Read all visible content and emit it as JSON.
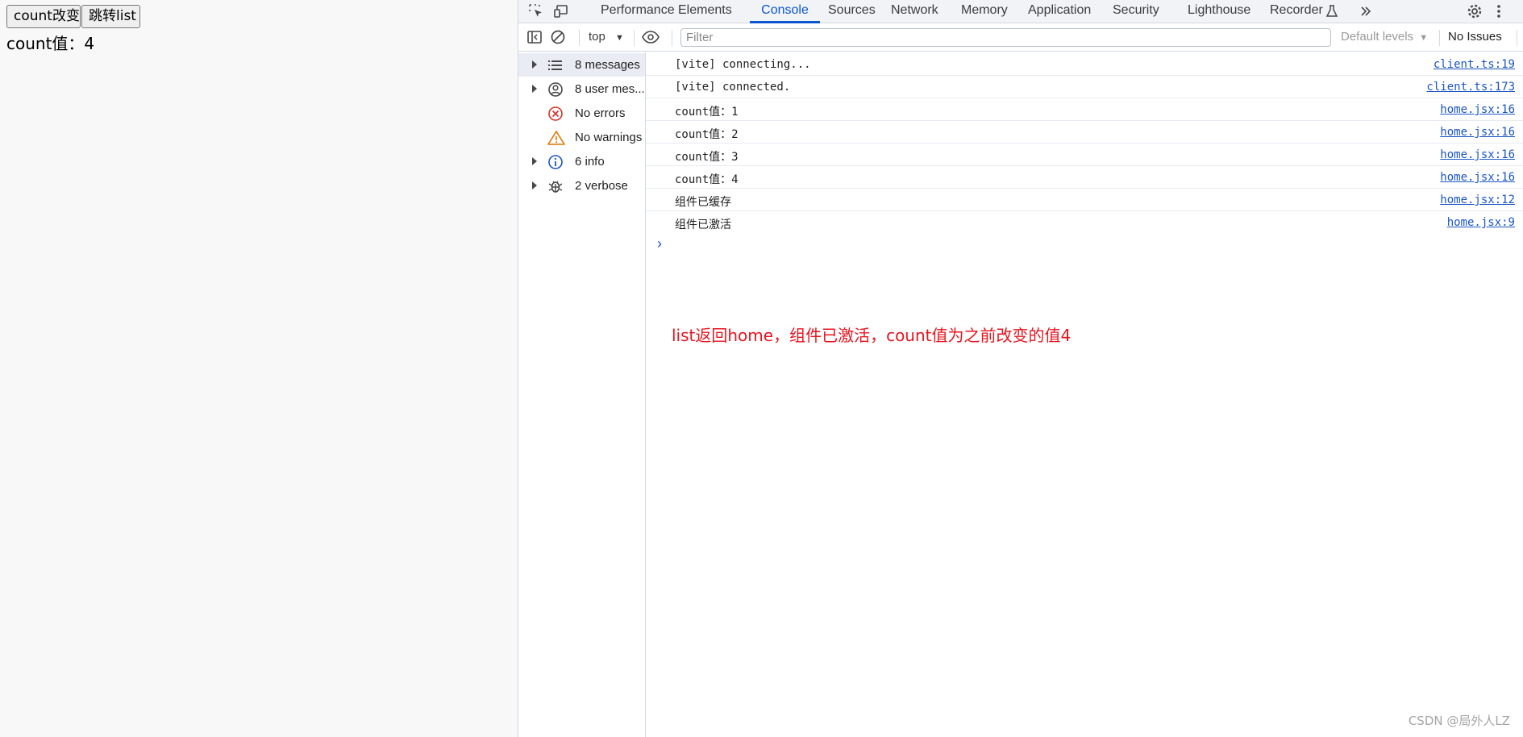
{
  "app": {
    "count_button": "count改变",
    "navigate_button": "跳转list",
    "count_display": "count值：4"
  },
  "devtools": {
    "tabs": [
      {
        "label": "Performance"
      },
      {
        "label": "Elements"
      },
      {
        "label": "Console",
        "active": true
      },
      {
        "label": "Sources"
      },
      {
        "label": "Network"
      },
      {
        "label": "Memory"
      },
      {
        "label": "Application"
      },
      {
        "label": "Security"
      },
      {
        "label": "Lighthouse"
      },
      {
        "label": "Recorder"
      }
    ],
    "toolbar": {
      "context": "top",
      "filter_placeholder": "Filter",
      "levels": "Default levels",
      "issues": "No Issues"
    },
    "sidebar": [
      {
        "label": "8 messages",
        "icon": "list-icon",
        "expandable": true,
        "selected": true
      },
      {
        "label": "8 user mes...",
        "icon": "user-icon",
        "expandable": true
      },
      {
        "label": "No errors",
        "icon": "error-icon",
        "expandable": false
      },
      {
        "label": "No warnings",
        "icon": "warning-icon",
        "expandable": false
      },
      {
        "label": "6 info",
        "icon": "info-icon",
        "expandable": true
      },
      {
        "label": "2 verbose",
        "icon": "bug-icon",
        "expandable": true
      }
    ],
    "messages": [
      {
        "text": "[vite] connecting...",
        "source": "client.ts:19"
      },
      {
        "text": "[vite] connected.",
        "source": "client.ts:173"
      },
      {
        "text": "count值：1",
        "source": "home.jsx:16"
      },
      {
        "text": "count值：2",
        "source": "home.jsx:16"
      },
      {
        "text": "count值：3",
        "source": "home.jsx:16"
      },
      {
        "text": "count值：4",
        "source": "home.jsx:16"
      },
      {
        "text": "组件已缓存",
        "source": "home.jsx:12"
      },
      {
        "text": "组件已激活",
        "source": "home.jsx:9"
      }
    ]
  },
  "annotation": "list返回home，组件已激活，count值为之前改变的值4",
  "watermark": "CSDN @局外人LZ",
  "colors": {
    "accent": "#0b57d0",
    "link": "#1a55c4",
    "annotation": "#e8141e",
    "error": "#d93025",
    "warning": "#e37400"
  }
}
